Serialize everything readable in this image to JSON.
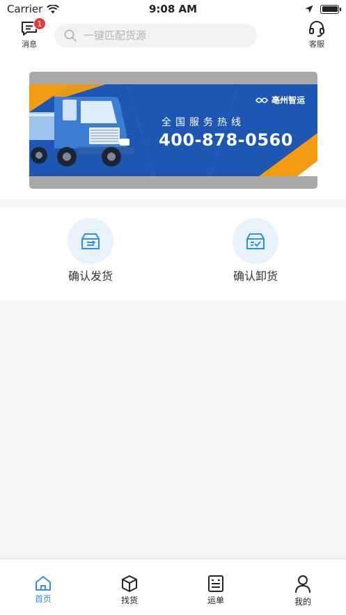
{
  "status_bar": {
    "carrier": "Carrier",
    "time": "9:08 AM"
  },
  "header": {
    "messages": {
      "label": "消息",
      "badge": "1",
      "icon": "message-icon"
    },
    "search": {
      "placeholder": "一键匹配货源",
      "icon": "search-icon"
    },
    "service": {
      "label": "客服",
      "icon": "headset-icon"
    }
  },
  "banner": {
    "logo_text": "亳州智运",
    "tagline": "全国服务热线",
    "phone": "400-878-0560",
    "colors": {
      "blue": "#1d57b3",
      "orange": "#f39c12",
      "truck": "#3b7ed6"
    }
  },
  "actions": [
    {
      "label": "确认发货",
      "icon": "ship-box-icon"
    },
    {
      "label": "确认卸货",
      "icon": "unload-box-icon"
    }
  ],
  "tabbar": {
    "active_color": "#2f8fe0",
    "items": [
      {
        "label": "首页",
        "icon": "home-icon",
        "active": true
      },
      {
        "label": "找货",
        "icon": "package-icon",
        "active": false
      },
      {
        "label": "运单",
        "icon": "waybill-icon",
        "active": false
      },
      {
        "label": "我的",
        "icon": "user-icon",
        "active": false
      }
    ]
  }
}
